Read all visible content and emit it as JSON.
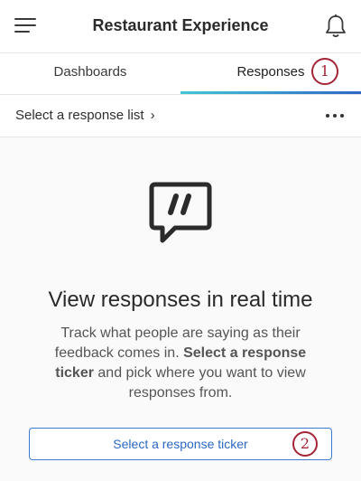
{
  "header": {
    "title": "Restaurant Experience",
    "menu_icon": "hamburger-menu-icon",
    "notification_icon": "bell-icon"
  },
  "tabs": [
    {
      "label": "Dashboards",
      "active": false
    },
    {
      "label": "Responses",
      "active": true
    }
  ],
  "tab_accent_colors": [
    "#42c7d6",
    "#2f67c6"
  ],
  "response_list": {
    "label": "Select a response list",
    "chevron": "›",
    "more_icon": "ellipsis-horizontal-icon"
  },
  "empty_state": {
    "icon": "quote-speech-bubble-icon",
    "headline": "View responses in real time",
    "desc_pre": "Track what people are saying as their feedback comes in.",
    "desc_bold": "Select a response ticker",
    "desc_post": "and pick where you want to view responses from.",
    "button_label": "Select a response ticker"
  },
  "annotations": {
    "marker_1": "1",
    "marker_2": "2",
    "marker_color": "#a32638"
  }
}
